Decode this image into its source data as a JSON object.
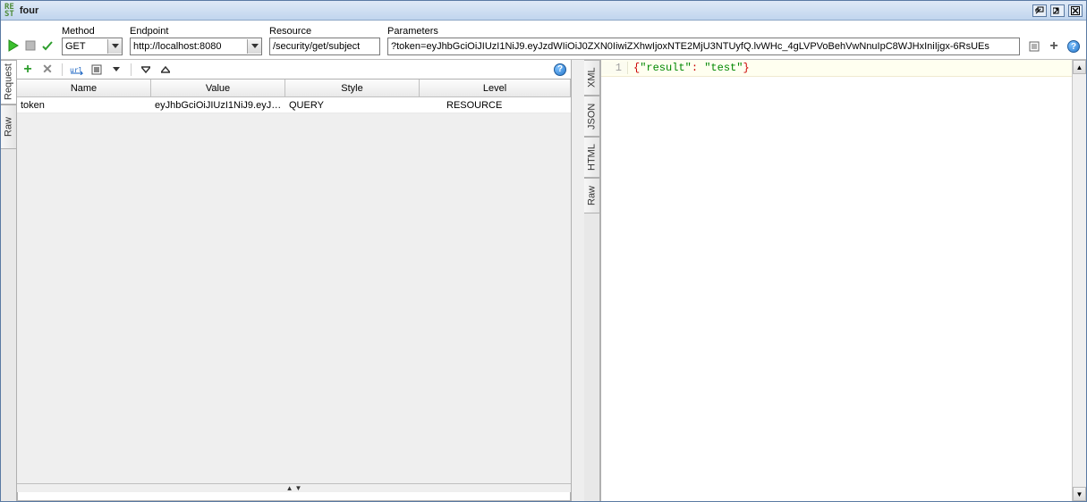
{
  "window": {
    "icon_text_top": "RE",
    "icon_text_bot": "ST",
    "title": "four"
  },
  "addr": {
    "method_label": "Method",
    "method_value": "GET",
    "endpoint_label": "Endpoint",
    "endpoint_value": "http://localhost:8080",
    "resource_label": "Resource",
    "resource_value": "/security/get/subject",
    "parameters_label": "Parameters",
    "parameters_value": "?token=eyJhbGciOiJIUzI1NiJ9.eyJzdWIiOiJ0ZXN0IiwiZXhwIjoxNTE2MjU3NTUyfQ.lvWHc_4gLVPVoBehVwNnuIpC8WJHxIniIjgx-6RsUEs"
  },
  "left_tabs": [
    "Request",
    "Raw"
  ],
  "req_table": {
    "headers": [
      "Name",
      "Value",
      "Style",
      "Level"
    ],
    "rows": [
      {
        "name": "token",
        "value": "eyJhbGciOiJIUzI1NiJ9.eyJz...",
        "style": "QUERY",
        "level": "RESOURCE"
      }
    ]
  },
  "right_tabs": [
    "XML",
    "JSON",
    "HTML",
    "Raw"
  ],
  "response": {
    "line_no": "1",
    "raw": "{\"result\": \"test\"}",
    "key": "\"result\"",
    "val": "\"test\""
  },
  "icons": {
    "plus": "+",
    "help": "?"
  }
}
